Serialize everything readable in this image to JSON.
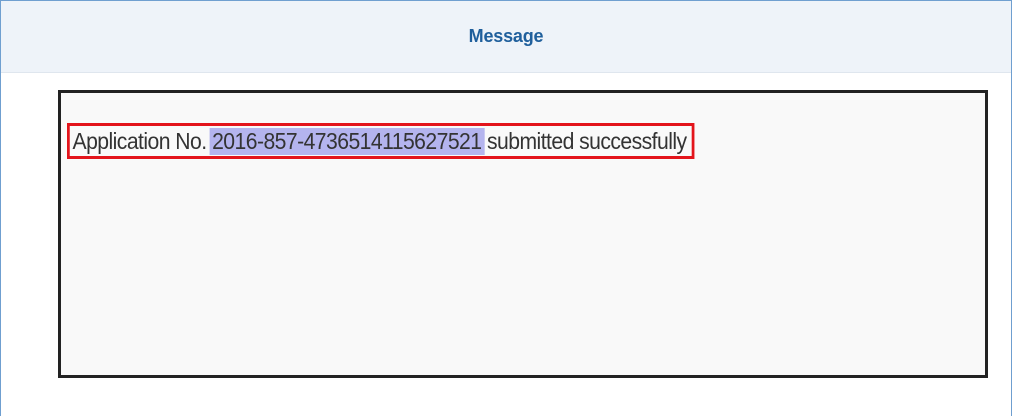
{
  "header": {
    "title": "Message"
  },
  "message": {
    "prefix": "Application No.",
    "application_number": "2016-857-4736514115627521",
    "suffix": "submitted successfully"
  },
  "colors": {
    "header_title": "#1f5f9c",
    "highlight_border": "#e3141b",
    "selection_background": "#b4b4ee"
  }
}
